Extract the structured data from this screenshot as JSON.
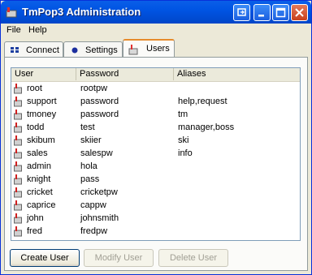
{
  "window": {
    "title": "TmPop3 Administration"
  },
  "menu": [
    {
      "label": "File"
    },
    {
      "label": "Help"
    }
  ],
  "tabs": [
    {
      "label": "Connect",
      "icon": "network-icon"
    },
    {
      "label": "Settings",
      "icon": "dot-icon"
    },
    {
      "label": "Users",
      "icon": "user-icon",
      "active": true
    }
  ],
  "users_table": {
    "columns": [
      "User",
      "Password",
      "Aliases"
    ],
    "rows": [
      {
        "user": "root",
        "password": "rootpw",
        "aliases": ""
      },
      {
        "user": "support",
        "password": "password",
        "aliases": "help,request"
      },
      {
        "user": "tmoney",
        "password": "password",
        "aliases": "tm"
      },
      {
        "user": "todd",
        "password": "test",
        "aliases": "manager,boss"
      },
      {
        "user": "skibum",
        "password": "skiier",
        "aliases": "ski"
      },
      {
        "user": "sales",
        "password": "salespw",
        "aliases": "info"
      },
      {
        "user": "admin",
        "password": "hola",
        "aliases": ""
      },
      {
        "user": "knight",
        "password": "pass",
        "aliases": ""
      },
      {
        "user": "cricket",
        "password": "cricketpw",
        "aliases": ""
      },
      {
        "user": "caprice",
        "password": "cappw",
        "aliases": ""
      },
      {
        "user": "john",
        "password": "johnsmith",
        "aliases": ""
      },
      {
        "user": "fred",
        "password": "fredpw",
        "aliases": ""
      }
    ]
  },
  "buttons": {
    "create": {
      "label": "Create User",
      "enabled": true
    },
    "modify": {
      "label": "Modify User",
      "enabled": false
    },
    "delete": {
      "label": "Delete User",
      "enabled": false
    }
  },
  "colors": {
    "titlebar": "#0054e3",
    "tab_highlight": "#e68b2c"
  }
}
